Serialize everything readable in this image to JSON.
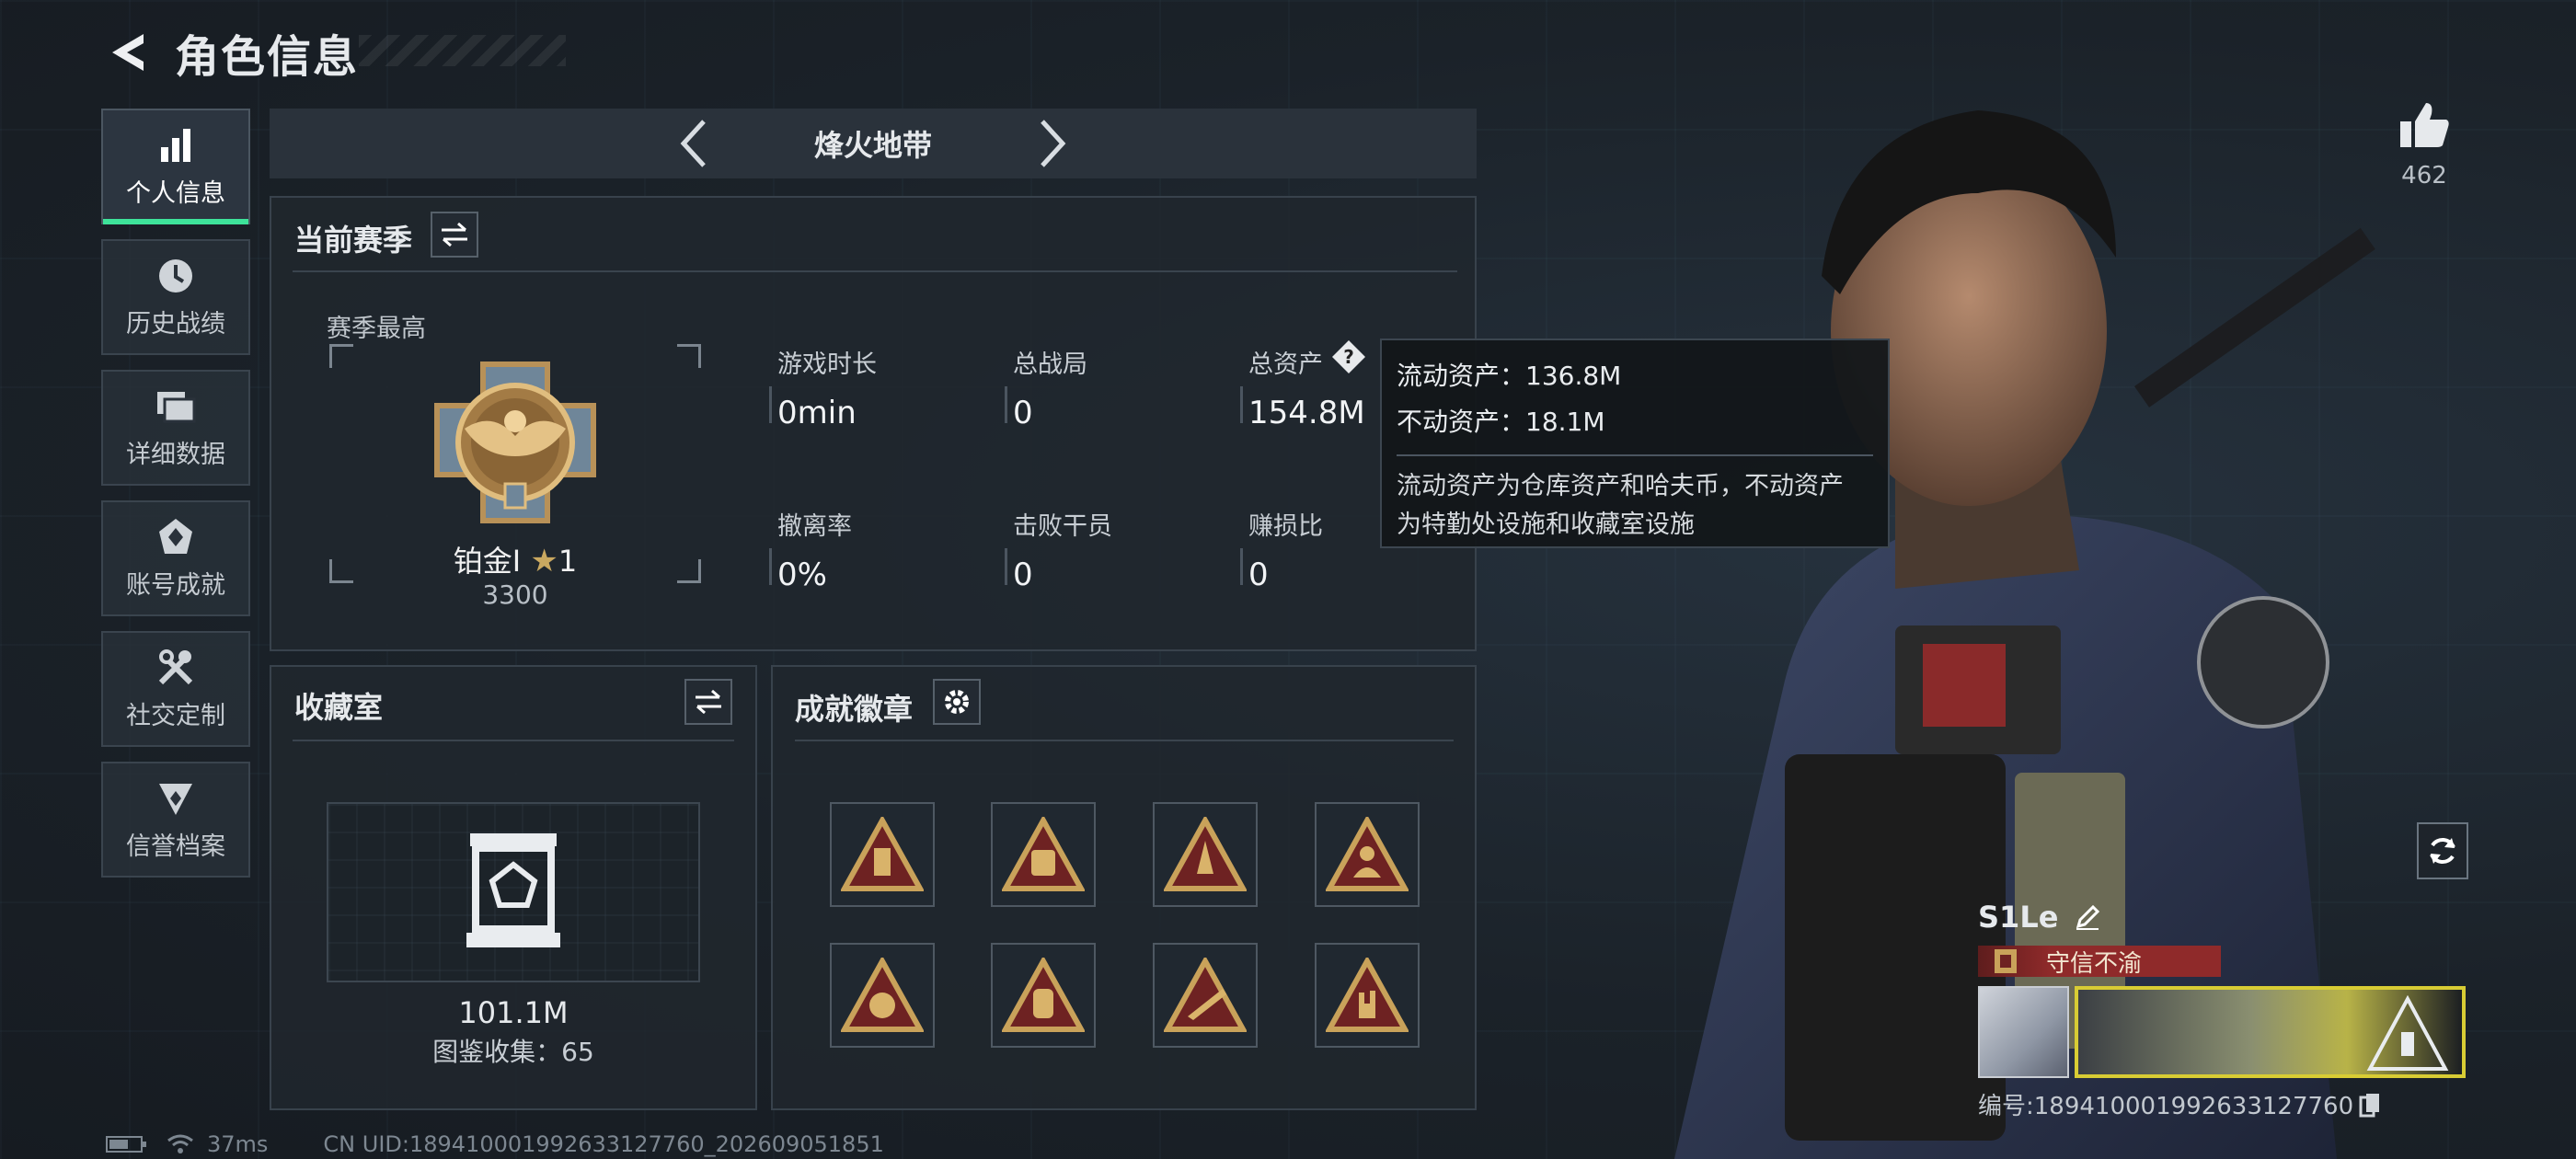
{
  "header": {
    "title": "角色信息"
  },
  "sidebar": {
    "items": [
      {
        "label": "个人信息",
        "icon": "bar-chart-icon",
        "active": true
      },
      {
        "label": "历史战绩",
        "icon": "clock-history-icon"
      },
      {
        "label": "详细数据",
        "icon": "folders-icon"
      },
      {
        "label": "账号成就",
        "icon": "achievement-icon"
      },
      {
        "label": "社交定制",
        "icon": "tools-icon"
      },
      {
        "label": "信誉档案",
        "icon": "reputation-icon"
      }
    ]
  },
  "map_selector": {
    "name": "烽火地带"
  },
  "season": {
    "title": "当前赛季",
    "best_label": "赛季最高",
    "rank_name": "铂金Ⅰ",
    "rank_stars": "1",
    "rank_points": "3300",
    "stats": [
      {
        "label": "游戏时长",
        "value": "0min"
      },
      {
        "label": "总战局",
        "value": "0"
      },
      {
        "label": "总资产",
        "value": "154.8M"
      },
      {
        "label": "撤离率",
        "value": "0%"
      },
      {
        "label": "击败干员",
        "value": "0"
      },
      {
        "label": "赚损比",
        "value": "0"
      }
    ]
  },
  "tooltip": {
    "liquid": "流动资产：136.8M",
    "fixed": "不动资产：18.1M",
    "desc_line1": "流动资产为仓库资产和哈夫币，不动资产",
    "desc_line2": "为特勤处设施和收藏室设施"
  },
  "collection": {
    "title": "收藏室",
    "value": "101.1M",
    "count": "图鉴收集：65"
  },
  "badges": {
    "title": "成就徽章"
  },
  "social": {
    "likes": "462"
  },
  "player": {
    "name": "S1Le",
    "title": "守信不渝",
    "id": "编号:18941000199263312776​0"
  },
  "footer": {
    "ping": "37ms",
    "uid": "CN UID:18941000199263312776​0_202609051851"
  },
  "colors": {
    "accent": "#3ee39a",
    "badge_gold": "#c9a25a",
    "badge_red": "#6e2222"
  }
}
